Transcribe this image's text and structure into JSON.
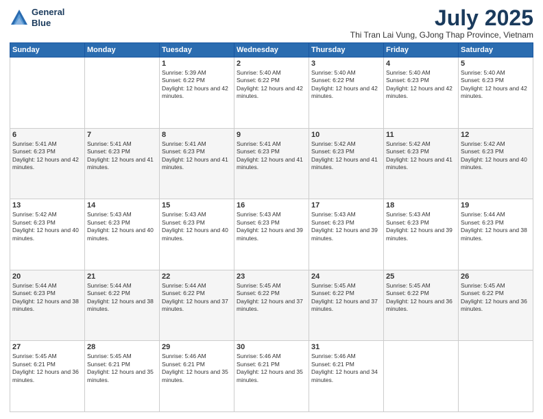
{
  "header": {
    "logo_line1": "General",
    "logo_line2": "Blue",
    "month_year": "July 2025",
    "subtitle": "Thi Tran Lai Vung, GJong Thap Province, Vietnam"
  },
  "days_of_week": [
    "Sunday",
    "Monday",
    "Tuesday",
    "Wednesday",
    "Thursday",
    "Friday",
    "Saturday"
  ],
  "weeks": [
    [
      {
        "day": "",
        "info": ""
      },
      {
        "day": "",
        "info": ""
      },
      {
        "day": "1",
        "info": "Sunrise: 5:39 AM\nSunset: 6:22 PM\nDaylight: 12 hours and 42 minutes."
      },
      {
        "day": "2",
        "info": "Sunrise: 5:40 AM\nSunset: 6:22 PM\nDaylight: 12 hours and 42 minutes."
      },
      {
        "day": "3",
        "info": "Sunrise: 5:40 AM\nSunset: 6:22 PM\nDaylight: 12 hours and 42 minutes."
      },
      {
        "day": "4",
        "info": "Sunrise: 5:40 AM\nSunset: 6:23 PM\nDaylight: 12 hours and 42 minutes."
      },
      {
        "day": "5",
        "info": "Sunrise: 5:40 AM\nSunset: 6:23 PM\nDaylight: 12 hours and 42 minutes."
      }
    ],
    [
      {
        "day": "6",
        "info": "Sunrise: 5:41 AM\nSunset: 6:23 PM\nDaylight: 12 hours and 42 minutes."
      },
      {
        "day": "7",
        "info": "Sunrise: 5:41 AM\nSunset: 6:23 PM\nDaylight: 12 hours and 41 minutes."
      },
      {
        "day": "8",
        "info": "Sunrise: 5:41 AM\nSunset: 6:23 PM\nDaylight: 12 hours and 41 minutes."
      },
      {
        "day": "9",
        "info": "Sunrise: 5:41 AM\nSunset: 6:23 PM\nDaylight: 12 hours and 41 minutes."
      },
      {
        "day": "10",
        "info": "Sunrise: 5:42 AM\nSunset: 6:23 PM\nDaylight: 12 hours and 41 minutes."
      },
      {
        "day": "11",
        "info": "Sunrise: 5:42 AM\nSunset: 6:23 PM\nDaylight: 12 hours and 41 minutes."
      },
      {
        "day": "12",
        "info": "Sunrise: 5:42 AM\nSunset: 6:23 PM\nDaylight: 12 hours and 40 minutes."
      }
    ],
    [
      {
        "day": "13",
        "info": "Sunrise: 5:42 AM\nSunset: 6:23 PM\nDaylight: 12 hours and 40 minutes."
      },
      {
        "day": "14",
        "info": "Sunrise: 5:43 AM\nSunset: 6:23 PM\nDaylight: 12 hours and 40 minutes."
      },
      {
        "day": "15",
        "info": "Sunrise: 5:43 AM\nSunset: 6:23 PM\nDaylight: 12 hours and 40 minutes."
      },
      {
        "day": "16",
        "info": "Sunrise: 5:43 AM\nSunset: 6:23 PM\nDaylight: 12 hours and 39 minutes."
      },
      {
        "day": "17",
        "info": "Sunrise: 5:43 AM\nSunset: 6:23 PM\nDaylight: 12 hours and 39 minutes."
      },
      {
        "day": "18",
        "info": "Sunrise: 5:43 AM\nSunset: 6:23 PM\nDaylight: 12 hours and 39 minutes."
      },
      {
        "day": "19",
        "info": "Sunrise: 5:44 AM\nSunset: 6:23 PM\nDaylight: 12 hours and 38 minutes."
      }
    ],
    [
      {
        "day": "20",
        "info": "Sunrise: 5:44 AM\nSunset: 6:23 PM\nDaylight: 12 hours and 38 minutes."
      },
      {
        "day": "21",
        "info": "Sunrise: 5:44 AM\nSunset: 6:22 PM\nDaylight: 12 hours and 38 minutes."
      },
      {
        "day": "22",
        "info": "Sunrise: 5:44 AM\nSunset: 6:22 PM\nDaylight: 12 hours and 37 minutes."
      },
      {
        "day": "23",
        "info": "Sunrise: 5:45 AM\nSunset: 6:22 PM\nDaylight: 12 hours and 37 minutes."
      },
      {
        "day": "24",
        "info": "Sunrise: 5:45 AM\nSunset: 6:22 PM\nDaylight: 12 hours and 37 minutes."
      },
      {
        "day": "25",
        "info": "Sunrise: 5:45 AM\nSunset: 6:22 PM\nDaylight: 12 hours and 36 minutes."
      },
      {
        "day": "26",
        "info": "Sunrise: 5:45 AM\nSunset: 6:22 PM\nDaylight: 12 hours and 36 minutes."
      }
    ],
    [
      {
        "day": "27",
        "info": "Sunrise: 5:45 AM\nSunset: 6:21 PM\nDaylight: 12 hours and 36 minutes."
      },
      {
        "day": "28",
        "info": "Sunrise: 5:45 AM\nSunset: 6:21 PM\nDaylight: 12 hours and 35 minutes."
      },
      {
        "day": "29",
        "info": "Sunrise: 5:46 AM\nSunset: 6:21 PM\nDaylight: 12 hours and 35 minutes."
      },
      {
        "day": "30",
        "info": "Sunrise: 5:46 AM\nSunset: 6:21 PM\nDaylight: 12 hours and 35 minutes."
      },
      {
        "day": "31",
        "info": "Sunrise: 5:46 AM\nSunset: 6:21 PM\nDaylight: 12 hours and 34 minutes."
      },
      {
        "day": "",
        "info": ""
      },
      {
        "day": "",
        "info": ""
      }
    ]
  ]
}
